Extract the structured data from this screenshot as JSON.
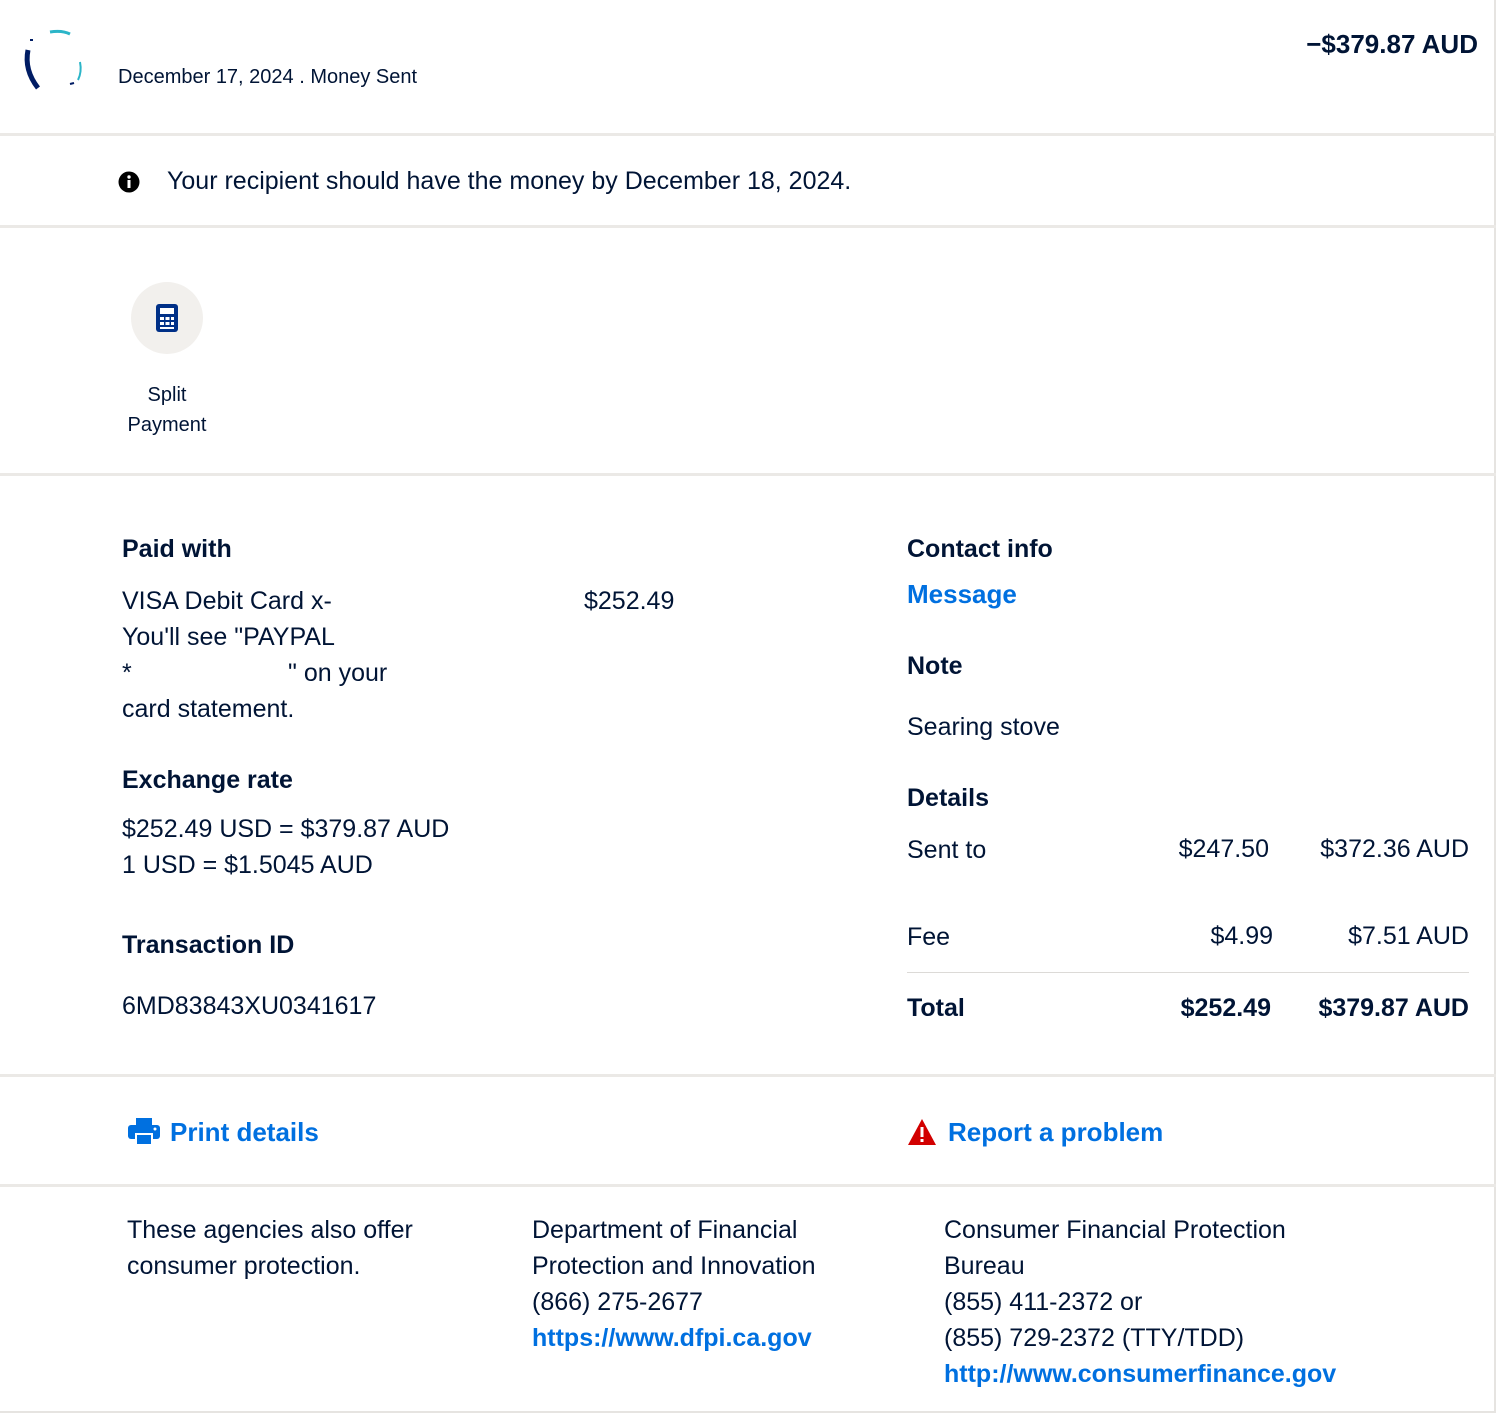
{
  "header": {
    "date_type": "December 17, 2024 . Money Sent",
    "amount": "−$379.87 AUD"
  },
  "banner": {
    "text": "Your recipient should have the money by December 18, 2024."
  },
  "split_payment": {
    "label_line1": "Split",
    "label_line2": "Payment"
  },
  "paid_with": {
    "heading": "Paid with",
    "line1": "VISA Debit Card x-",
    "line2": "You'll see \"PAYPAL",
    "line3_start": "*",
    "line3_end": "\" on your",
    "line4": "card statement.",
    "amount": "$252.49"
  },
  "exchange_rate": {
    "heading": "Exchange rate",
    "line1": "$252.49 USD = $379.87 AUD",
    "line2": "1 USD = $1.5045 AUD"
  },
  "transaction": {
    "heading": "Transaction ID",
    "id": "6MD83843XU0341617"
  },
  "contact": {
    "heading": "Contact info",
    "message_link": "Message"
  },
  "note": {
    "heading": "Note",
    "text": "Searing stove"
  },
  "details": {
    "heading": "Details",
    "rows": [
      {
        "label": "Sent to",
        "usd": "$247.50",
        "aud": "$372.36 AUD"
      },
      {
        "label": "Fee",
        "usd": "$4.99",
        "aud": "$7.51 AUD"
      }
    ],
    "total": {
      "label": "Total",
      "usd": "$252.49",
      "aud": "$379.87 AUD"
    }
  },
  "actions": {
    "print": "Print details",
    "report": "Report a problem"
  },
  "footer": {
    "intro_line1": "These agencies also offer",
    "intro_line2": "consumer protection.",
    "dfpi": {
      "line1": "Department of Financial",
      "line2": "Protection and Innovation",
      "phone": "(866) 275-2677",
      "url": "https://www.dfpi.ca.gov"
    },
    "cfpb": {
      "line1": "Consumer Financial Protection",
      "line2": "Bureau",
      "phone1": "(855) 411-2372 or",
      "phone2": "(855) 729-2372 (TTY/TDD)",
      "url": "http://www.consumerfinance.gov"
    }
  },
  "colors": {
    "text": "#001435",
    "link": "#0070e0",
    "warning": "#d20000",
    "divider": "#ebe9e6"
  },
  "icons": [
    "avatar-logo",
    "info-icon",
    "calculator-icon",
    "printer-icon",
    "warning-icon"
  ]
}
